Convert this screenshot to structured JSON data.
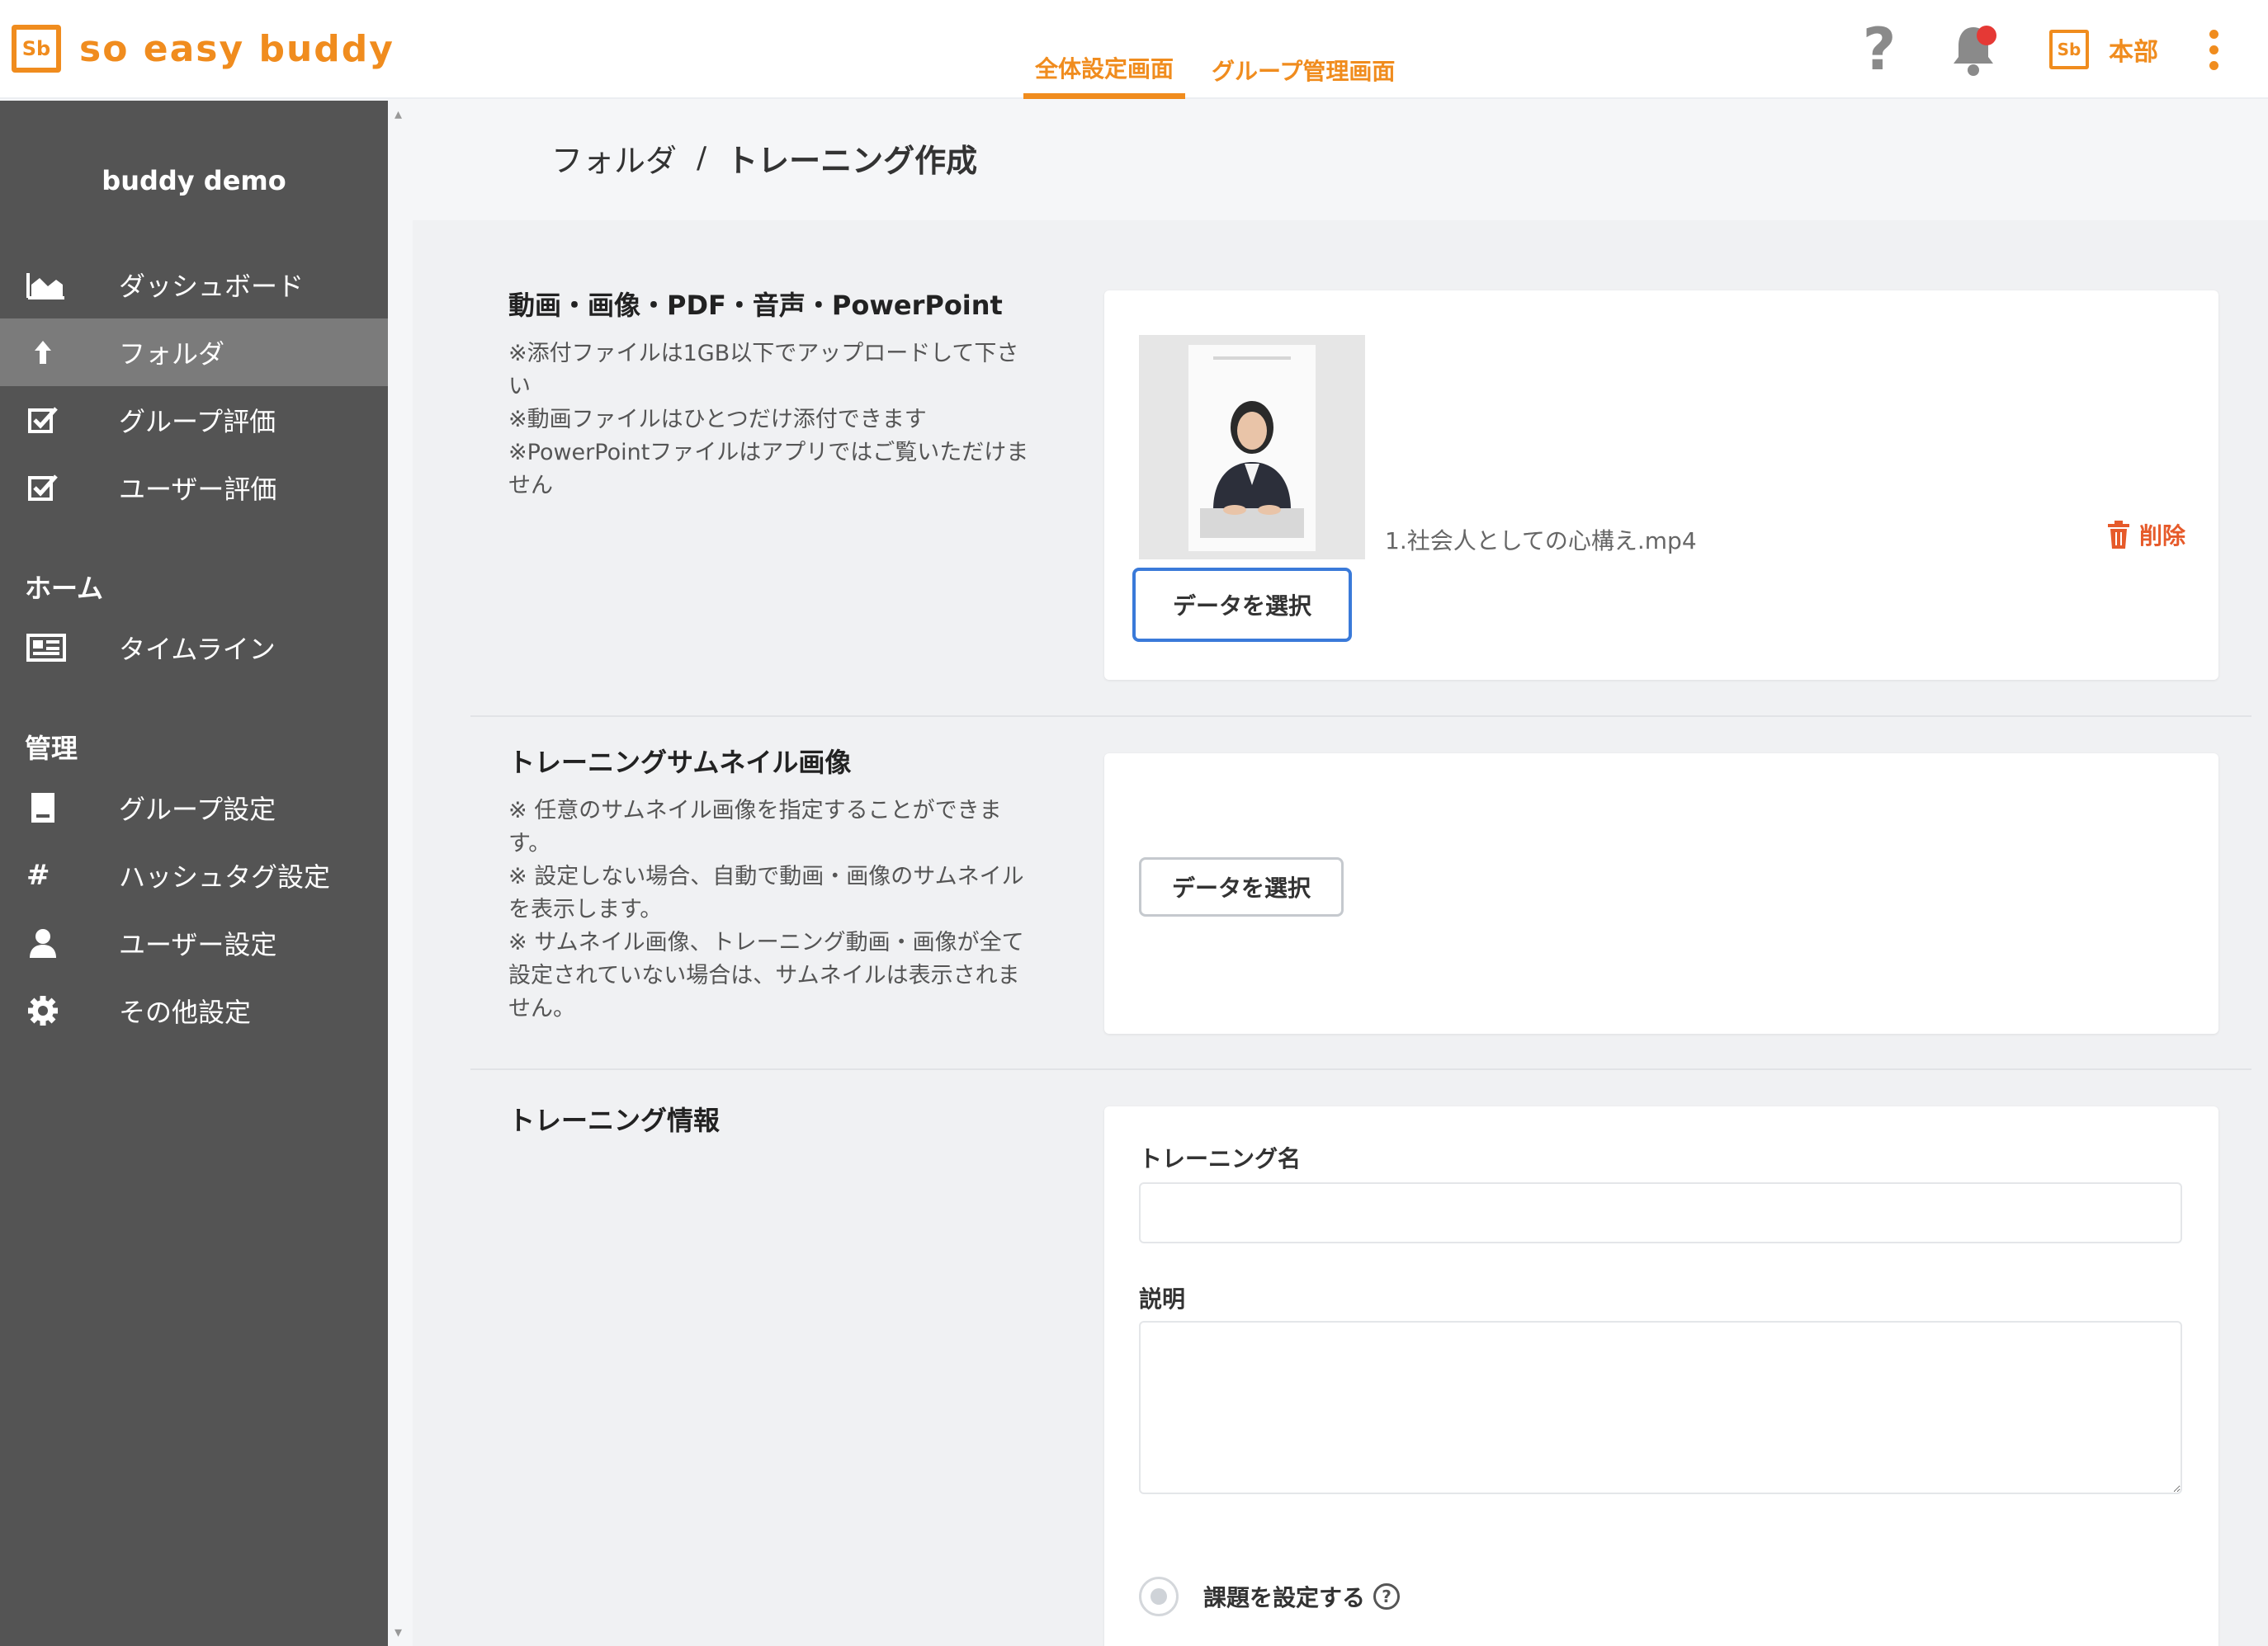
{
  "header": {
    "logo_mark": "Sb",
    "logo_text": "so easy buddy",
    "tabs": [
      {
        "label": "全体設定画面",
        "active": true
      },
      {
        "label": "グループ管理画面",
        "active": false
      }
    ],
    "help_glyph": "?",
    "org_badge": "Sb",
    "org_name": "本部",
    "accent_color": "#f08c1e",
    "notification_color": "#e53935"
  },
  "sidebar": {
    "title": "buddy demo",
    "items": [
      {
        "label": "ダッシュボード",
        "icon": "chart-icon"
      },
      {
        "label": "フォルダ",
        "icon": "upload-arrow-icon",
        "active": true
      },
      {
        "label": "グループ評価",
        "icon": "checkbox-icon"
      },
      {
        "label": "ユーザー評価",
        "icon": "checkbox-icon"
      }
    ],
    "sections": [
      {
        "title": "ホーム",
        "items": [
          {
            "label": "タイムライン",
            "icon": "timeline-icon"
          }
        ]
      },
      {
        "title": "管理",
        "items": [
          {
            "label": "グループ設定",
            "icon": "document-icon"
          },
          {
            "label": "ハッシュタグ設定",
            "icon": "hash-icon"
          },
          {
            "label": "ユーザー設定",
            "icon": "user-icon"
          },
          {
            "label": "その他設定",
            "icon": "gear-icon"
          }
        ]
      }
    ]
  },
  "breadcrumb": {
    "parent": "フォルダ",
    "separator": "/",
    "current": "トレーニング作成"
  },
  "media_section": {
    "title": "動画・画像・PDF・音声・PowerPoint",
    "notes": [
      "※添付ファイルは1GB以下でアップロードして下さい",
      "※動画ファイルはひとつだけ添付できます",
      "※PowerPointファイルはアプリではご覧いただけません"
    ],
    "file_name": "1.社会人としての心構え.mp4",
    "delete_label": "削除",
    "select_button": "データを選択"
  },
  "thumbnail_section": {
    "title": "トレーニングサムネイル画像",
    "notes": [
      "※ 任意のサムネイル画像を指定することができます。",
      "※ 設定しない場合、自動で動画・画像のサムネイルを表示します。",
      "※ サムネイル画像、トレーニング動画・画像が全て設定されていない場合は、サムネイルは表示されません。"
    ],
    "select_button": "データを選択"
  },
  "info_section": {
    "title": "トレーニング情報",
    "name_label": "トレーニング名",
    "name_value": "",
    "description_label": "説明",
    "description_value": "",
    "assignment_label": "課題を設定する",
    "help_glyph": "?"
  }
}
